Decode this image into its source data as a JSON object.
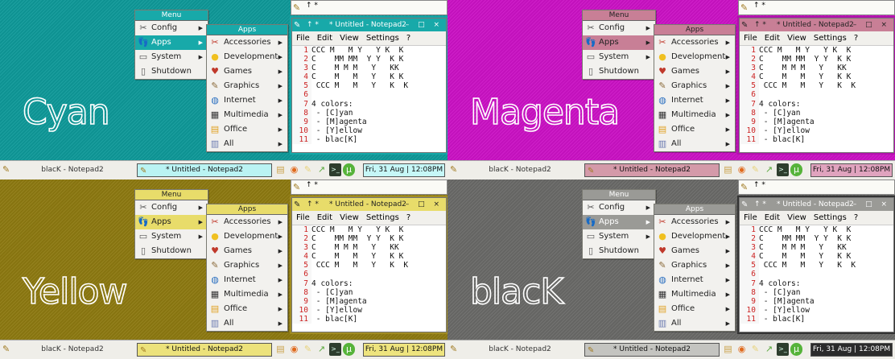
{
  "themes": [
    {
      "name": "Cyan",
      "desktop": "#0f9a9a",
      "accent": "#18a9a9",
      "accent_text": "#ffffff",
      "frame": "#14a7a7",
      "task_bg": "#baf3f3",
      "clock_bg": "#c6f7f7"
    },
    {
      "name": "Magenta",
      "desktop": "#cc12c6",
      "accent": "#c87f96",
      "accent_text": "#222222",
      "frame": "#b112ab",
      "task_bg": "#d49aa9",
      "clock_bg": "#e0a3be"
    },
    {
      "name": "Yellow",
      "desktop": "#8e7a11",
      "accent": "#e8dc6a",
      "accent_text": "#222222",
      "frame": "#a08b21",
      "task_bg": "#ece27b",
      "clock_bg": "#eee47e"
    },
    {
      "name": "blacK",
      "desktop": "#6a6a68",
      "accent": "#9a9a96",
      "accent_text": "#ffffff",
      "frame": "#333333",
      "task_bg": "#c4c4c0",
      "clock_bg": "#2b2b2b"
    }
  ],
  "menu": {
    "title": "Menu",
    "items": [
      {
        "label": "Config",
        "icon": "config-icon",
        "glyph": "✂"
      },
      {
        "label": "Apps",
        "icon": "apps-icon",
        "glyph": "👣"
      },
      {
        "label": "System",
        "icon": "system-icon",
        "glyph": "▭"
      },
      {
        "label": "Shutdown",
        "icon": "shutdown-icon",
        "glyph": "▯"
      }
    ]
  },
  "apps_menu": {
    "title": "Apps",
    "items": [
      {
        "label": "Accessories",
        "icon": "accessories-icon",
        "glyph": "✂"
      },
      {
        "label": "Development",
        "icon": "development-icon",
        "glyph": "●"
      },
      {
        "label": "Games",
        "icon": "games-icon",
        "glyph": "♥"
      },
      {
        "label": "Graphics",
        "icon": "graphics-icon",
        "glyph": "✎"
      },
      {
        "label": "Internet",
        "icon": "internet-icon",
        "glyph": "◍"
      },
      {
        "label": "Multimedia",
        "icon": "multimedia-icon",
        "glyph": "▦"
      },
      {
        "label": "Office",
        "icon": "office-icon",
        "glyph": "▤"
      },
      {
        "label": "All",
        "icon": "all-icon",
        "glyph": "▥"
      }
    ]
  },
  "notepad": {
    "top_bar_text": "↑ *",
    "title": "* Untitled - Notepad2",
    "arrows": "↑ *",
    "buttons": "– □ ×",
    "menu": [
      "File",
      "Edit",
      "View",
      "Settings",
      "?"
    ],
    "lines": [
      {
        "n": "1",
        "text": "CCC M   M Y   Y K  K"
      },
      {
        "n": "2",
        "text": "C    MM MM  Y Y  K K"
      },
      {
        "n": "3",
        "text": "C    M M M   Y   KK"
      },
      {
        "n": "4",
        "text": "C    M   M   Y   K K"
      },
      {
        "n": "5",
        "text": " CCC M   M   Y   K  K"
      },
      {
        "n": "6",
        "text": ""
      },
      {
        "n": "7",
        "text": "4 colors:"
      },
      {
        "n": "8",
        "text": " - [C]yan"
      },
      {
        "n": "9",
        "text": " - [M]agenta"
      },
      {
        "n": "10",
        "text": " - [Y]ellow"
      },
      {
        "n": "11",
        "text": " - blac[K]"
      }
    ]
  },
  "taskbar": {
    "task1": "blacK - Notepad2",
    "task2": "* Untitled - Notepad2",
    "clock": "Fri, 31 Aug | 12:08PM",
    "tray": [
      {
        "icon": "folder-icon",
        "glyph": "▤",
        "color": "#caa24a"
      },
      {
        "icon": "firefox-icon",
        "glyph": "◉",
        "color": "#e06a1d"
      },
      {
        "icon": "notes-icon",
        "glyph": "✎",
        "color": "#e8d27a"
      },
      {
        "icon": "arrow-icon",
        "glyph": "↗",
        "color": "#59a83c"
      },
      {
        "icon": "terminal-icon",
        "glyph": ">_",
        "color": "#2d3d2d"
      },
      {
        "icon": "utorrent-icon",
        "glyph": "µ",
        "color": "#56b33a"
      }
    ]
  }
}
